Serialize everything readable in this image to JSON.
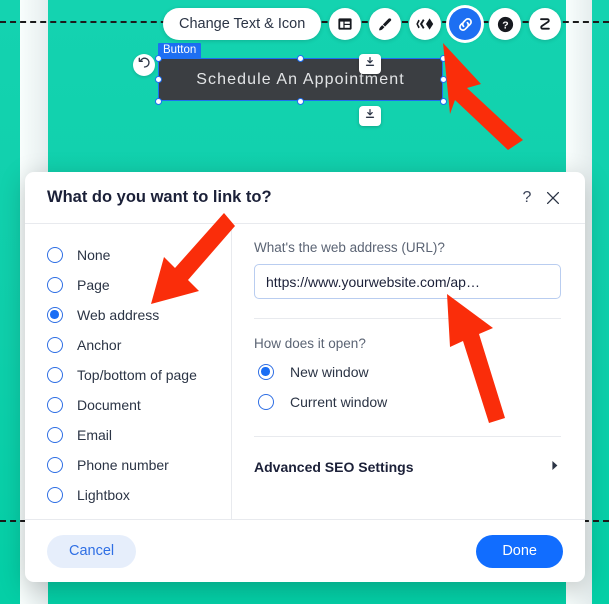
{
  "canvas": {
    "background_color": "#0fcfab",
    "element": {
      "tag_label": "Button",
      "button_text": "Schedule An Appointment",
      "undo_icon": "undo-icon",
      "anchor_icon_top": "anchor-down-icon",
      "anchor_icon_bottom": "anchor-down-icon"
    }
  },
  "toolbar": {
    "change_text_icon_label": "Change Text & Icon",
    "items": [
      {
        "name": "layout-icon",
        "icon": "layout-icon",
        "active": false
      },
      {
        "name": "design-icon",
        "icon": "paintbrush-icon",
        "active": false
      },
      {
        "name": "animation-icon",
        "icon": "animation-icon",
        "active": false
      },
      {
        "name": "link-icon",
        "icon": "link-icon",
        "active": true
      },
      {
        "name": "help-icon",
        "icon": "help-icon",
        "active": false
      },
      {
        "name": "stretch-icon",
        "icon": "stretch-icon",
        "active": false
      }
    ]
  },
  "dialog": {
    "title": "What do you want to link to?",
    "help_icon": "?",
    "close_icon": "close-icon",
    "link_types": [
      {
        "label": "None",
        "selected": false
      },
      {
        "label": "Page",
        "selected": false
      },
      {
        "label": "Web address",
        "selected": true
      },
      {
        "label": "Anchor",
        "selected": false
      },
      {
        "label": "Top/bottom of page",
        "selected": false
      },
      {
        "label": "Document",
        "selected": false
      },
      {
        "label": "Email",
        "selected": false
      },
      {
        "label": "Phone number",
        "selected": false
      },
      {
        "label": "Lightbox",
        "selected": false
      }
    ],
    "url_field": {
      "label": "What's the web address (URL)?",
      "value": "https://www.yourwebsite.com/ap…",
      "placeholder": "https://www."
    },
    "open_behavior": {
      "label": "How does it open?",
      "options": [
        {
          "label": "New window",
          "selected": true
        },
        {
          "label": "Current window",
          "selected": false
        }
      ]
    },
    "advanced_seo": {
      "label": "Advanced SEO Settings",
      "expand_icon": "chevron-right-icon"
    },
    "footer": {
      "cancel_label": "Cancel",
      "done_label": "Done"
    },
    "colors": {
      "accent_blue": "#116dff",
      "radio_blue": "#1a6ef5",
      "title_text": "#1b2038",
      "muted_text": "#5b6474"
    }
  },
  "annotations": {
    "arrow_color": "#fa2d0a",
    "arrows": [
      {
        "name": "arrow-to-link-icon",
        "points_at": "link-icon"
      },
      {
        "name": "arrow-to-web-address-option",
        "points_at": "Web address"
      },
      {
        "name": "arrow-to-url-input",
        "points_at": "url-input"
      }
    ]
  }
}
